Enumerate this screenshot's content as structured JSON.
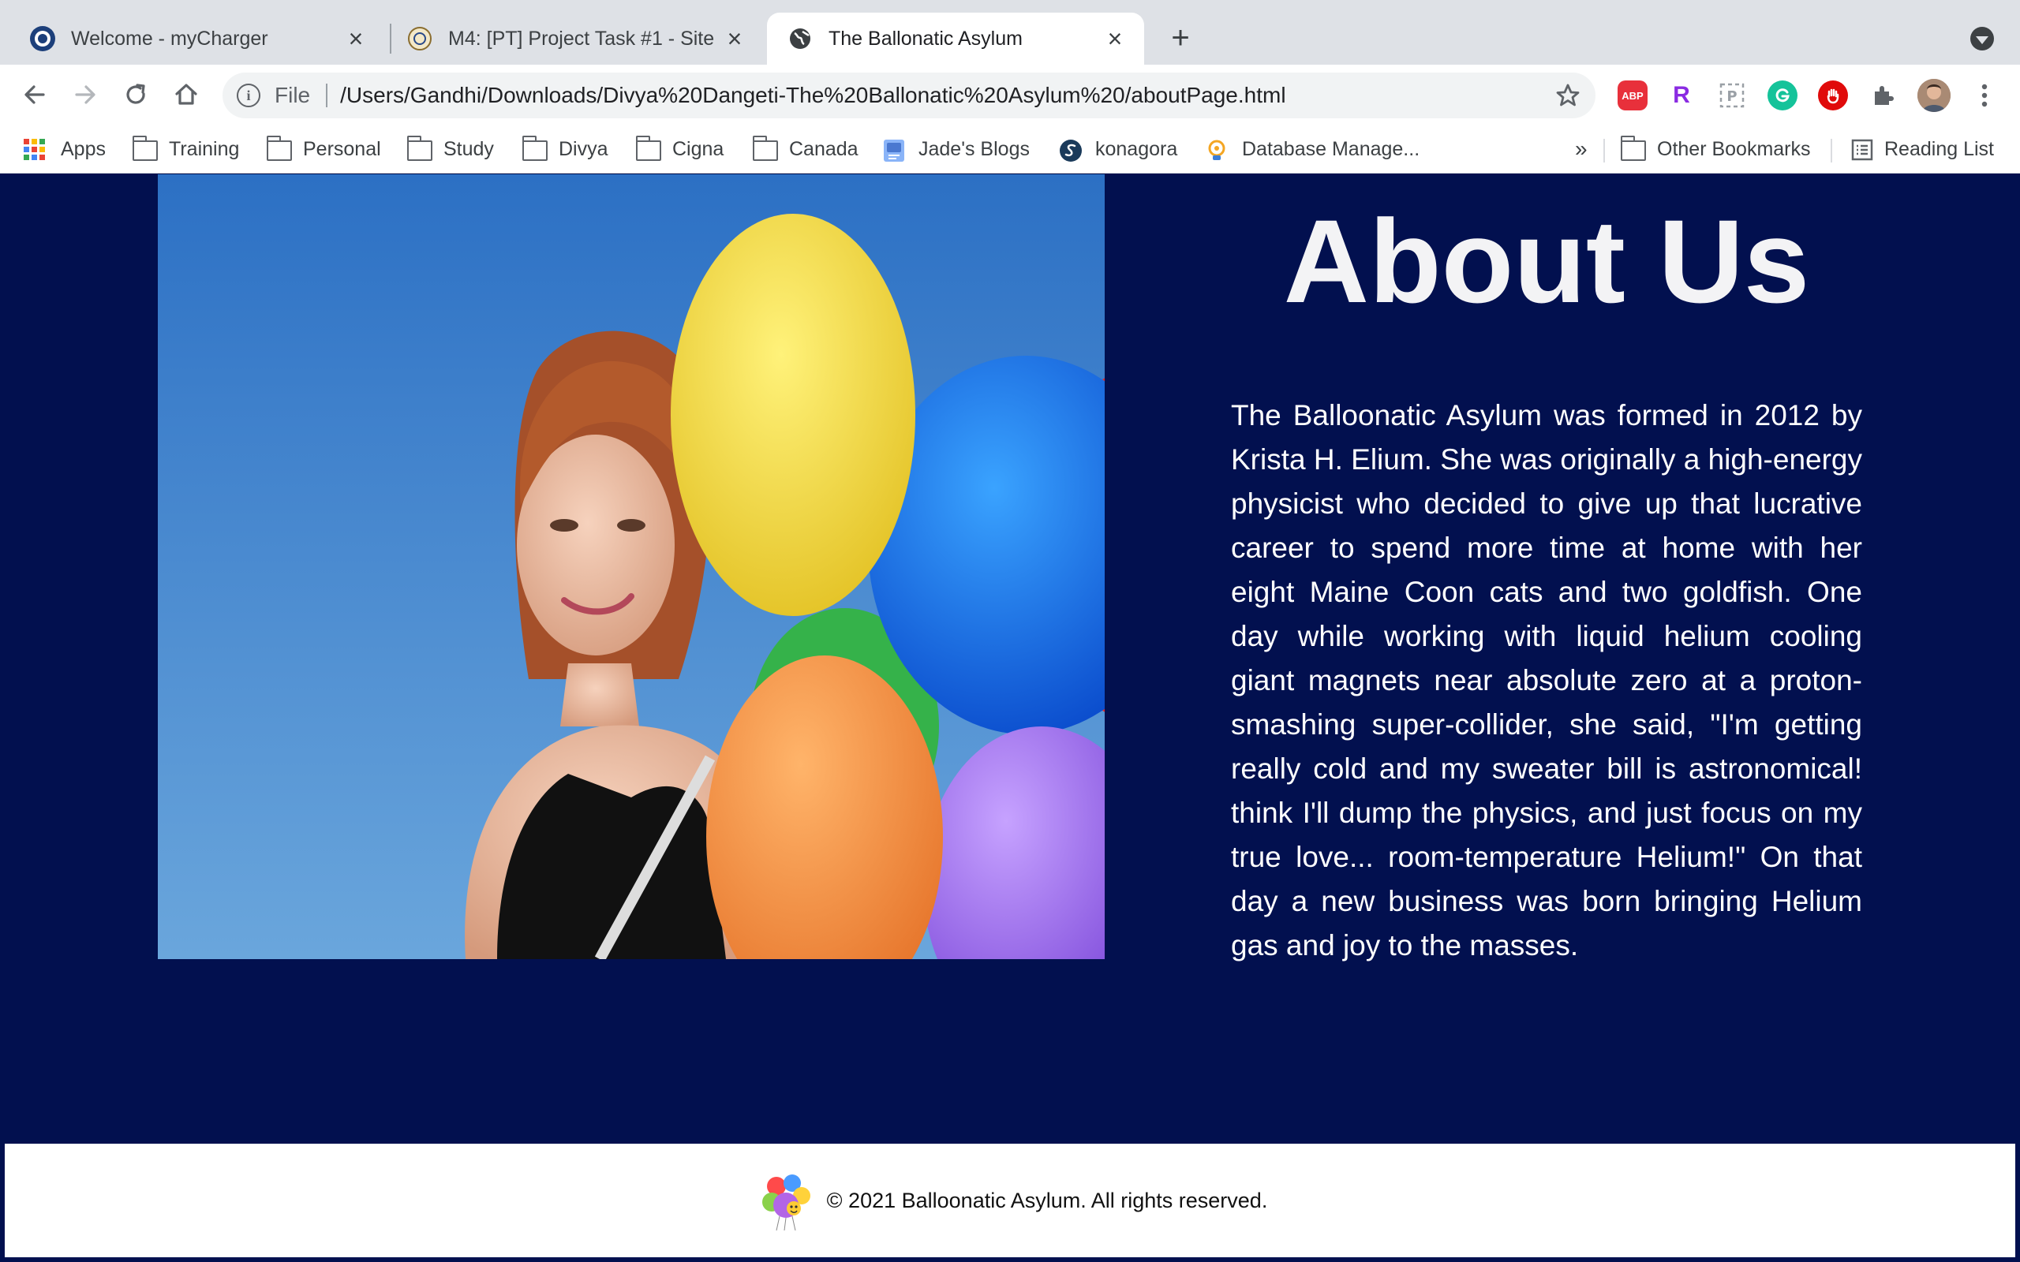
{
  "browser": {
    "tabs": [
      {
        "title": "Welcome - myCharger",
        "active": false,
        "icon": "mycharger-seal-icon"
      },
      {
        "title": "M4: [PT] Project Task #1 - Site",
        "active": false,
        "icon": "university-seal-icon"
      },
      {
        "title": "The Ballonatic Asylum",
        "active": true,
        "icon": "globe-icon"
      }
    ],
    "omnibox": {
      "scheme": "File",
      "url": "/Users/Gandhi/Downloads/Divya%20Dangeti-The%20Ballonatic%20Asylum%20/aboutPage.html"
    },
    "extensions": [
      {
        "name": "adblock-plus-icon",
        "text": "ABP",
        "color": "#e8303b"
      },
      {
        "name": "r-extension-icon",
        "text": "R",
        "color": "#8a2be2"
      },
      {
        "name": "screenshot-extension-icon",
        "text": "",
        "color": "#9aa0a6"
      },
      {
        "name": "grammarly-icon",
        "text": "",
        "color": "#15c39a"
      },
      {
        "name": "stop-hand-icon",
        "text": "",
        "color": "#e00b0b"
      },
      {
        "name": "puzzle-extensions-icon",
        "text": "",
        "color": "#5f6368"
      }
    ],
    "bookmarks": [
      {
        "label": "Apps",
        "type": "apps"
      },
      {
        "label": "Training",
        "type": "folder"
      },
      {
        "label": "Personal",
        "type": "folder"
      },
      {
        "label": "Study",
        "type": "folder"
      },
      {
        "label": "Divya",
        "type": "folder"
      },
      {
        "label": "Cigna",
        "type": "folder"
      },
      {
        "label": "Canada",
        "type": "folder"
      },
      {
        "label": "Jade's Blogs",
        "type": "page"
      },
      {
        "label": "konagora",
        "type": "site"
      },
      {
        "label": "Database Manage...",
        "type": "site"
      }
    ],
    "bookmarks_overflow": "»",
    "other_bookmarks": "Other Bookmarks",
    "reading_list": "Reading List"
  },
  "page": {
    "title": "About Us",
    "body": "The Balloonatic Asylum was formed in 2012 by Krista H. Elium. She was originally a high-energy physicist who decided to give up that lucrative career to spend more time at home with her eight Maine Coon cats and two goldfish. One day while working with liquid helium cooling giant magnets near absolute zero at a proton-smashing super-collider, she said, \"I'm getting really cold and my sweater bill is astronomical! think I'll dump the physics, and just focus on my true love... room-temperature Helium!\" On that day a new business was born bringing Helium gas and joy to the masses.",
    "background_color": "#02104f"
  },
  "footer": {
    "copyright": "© 2021 Balloonatic Asylum. All rights reserved."
  }
}
